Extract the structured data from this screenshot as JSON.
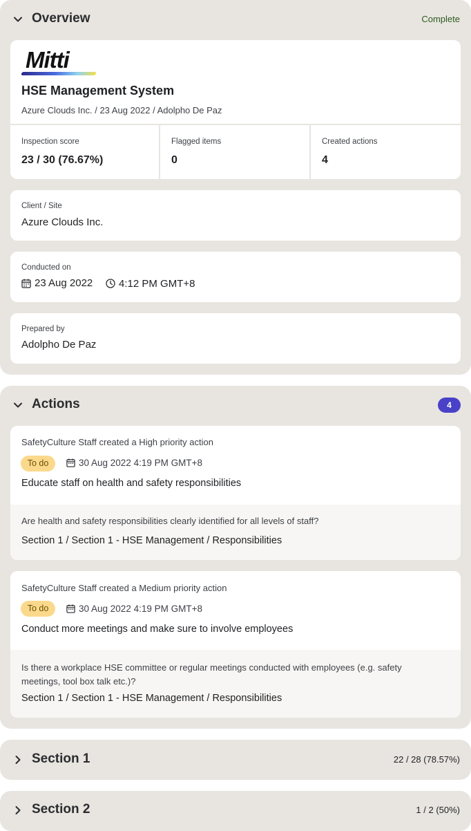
{
  "overview": {
    "title": "Overview",
    "status": "Complete",
    "status_color": "#2d5a1e",
    "logo_text": "Mitti",
    "system_title": "HSE Management System",
    "subtitle": "Azure Clouds Inc. / 23 Aug 2022 / Adolpho De Paz",
    "stats": [
      {
        "label": "Inspection score",
        "value": "23 / 30 (76.67%)"
      },
      {
        "label": "Flagged items",
        "value": "0"
      },
      {
        "label": "Created actions",
        "value": "4"
      }
    ],
    "client": {
      "label": "Client / Site",
      "value": "Azure Clouds Inc."
    },
    "conducted": {
      "label": "Conducted on",
      "date": "23 Aug 2022",
      "time": "4:12 PM GMT+8"
    },
    "prepared": {
      "label": "Prepared by",
      "value": "Adolpho De Paz"
    }
  },
  "actions": {
    "title": "Actions",
    "count": "4",
    "badge_color": "#4a41c9",
    "items": [
      {
        "creator": "SafetyCulture Staff created a High priority action",
        "status": "To do",
        "due": "30 Aug 2022 4:19 PM GMT+8",
        "title": "Educate staff on health and safety responsibilities",
        "question": "Are health and safety responsibilities clearly identified for all levels of staff?",
        "path": "Section 1 / Section 1 - HSE Management / Responsibilities"
      },
      {
        "creator": "SafetyCulture Staff created a Medium priority action",
        "status": "To do",
        "due": "30 Aug 2022 4:19 PM GMT+8",
        "title": "Conduct more meetings and make sure to involve employees",
        "question": "Is there a workplace HSE committee or regular meetings conducted with employees (e.g. safety meetings, tool box talk etc.)?",
        "path": "Section 1 / Section 1 - HSE Management / Responsibilities"
      }
    ]
  },
  "sections": [
    {
      "title": "Section 1",
      "score": "22 / 28 (78.57%)"
    },
    {
      "title": "Section 2",
      "score": "1 / 2 (50%)"
    }
  ]
}
